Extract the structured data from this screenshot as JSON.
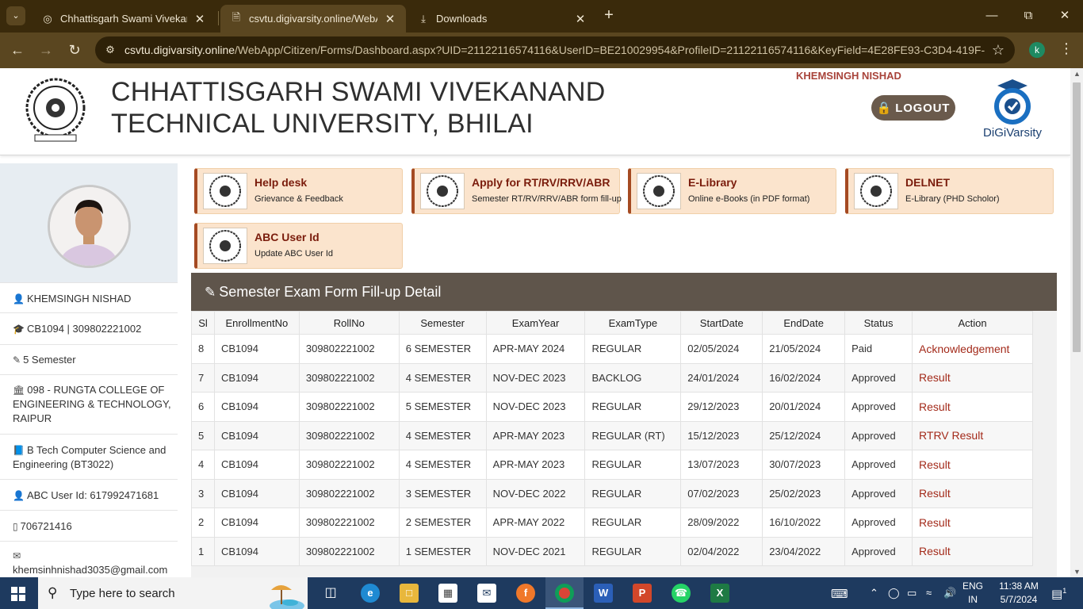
{
  "browser": {
    "tabs": [
      {
        "title": "Chhattisgarh Swami Vivekananda"
      },
      {
        "title": "csvtu.digivarsity.online/WebApp"
      },
      {
        "title": "Downloads"
      }
    ],
    "url_host": "csvtu.digivarsity.online",
    "url_path": "/WebApp/Citizen/Forms/Dashboard.aspx?UID=21122116574116&UserID=BE210029954&ProfileID=21122116574116&KeyField=4E28FE93-C3D4-419F-...",
    "profile_initial": "k"
  },
  "header": {
    "university_line1": "CHHATTISGARH SWAMI VIVEKANAND",
    "university_line2": "TECHNICAL UNIVERSITY, BHILAI",
    "user_name": "KHEMSINGH NISHAD",
    "logout_label": "LOGOUT",
    "logo_caption": "DiGiVarsity"
  },
  "sidebar": {
    "name": "KHEMSINGH NISHAD",
    "enrollment": "CB1094 | 309802221002",
    "semester": "5 Semester",
    "college": "098 - RUNGTA COLLEGE OF ENGINEERING & TECHNOLOGY, RAIPUR",
    "course": "B Tech Computer Science and Engineering (BT3022)",
    "abc_id": "ABC User Id: 617992471681",
    "phone": "706721416",
    "email": "khemsinhnishad3035@gmail.com"
  },
  "cards": [
    {
      "title": "Help desk",
      "subtitle": "Grievance & Feedback"
    },
    {
      "title": "Apply for RT/RV/RRV/ABR",
      "subtitle": "Semester RT/RV/RRV/ABR form fill-up"
    },
    {
      "title": "E-Library",
      "subtitle": "Online e-Books (in PDF format)"
    },
    {
      "title": "DELNET",
      "subtitle": "E-Library (PHD Scholor)"
    },
    {
      "title": "ABC User Id",
      "subtitle": "Update ABC User Id"
    }
  ],
  "exam_panel": {
    "title": "Semester Exam Form Fill-up Detail",
    "columns": [
      "Sl",
      "EnrollmentNo",
      "RollNo",
      "Semester",
      "ExamYear",
      "ExamType",
      "StartDate",
      "EndDate",
      "Status",
      "Action"
    ],
    "rows": [
      [
        "8",
        "CB1094",
        "309802221002",
        "6 SEMESTER",
        "APR-MAY 2024",
        "REGULAR",
        "02/05/2024",
        "21/05/2024",
        "Paid",
        "Acknowledgement"
      ],
      [
        "7",
        "CB1094",
        "309802221002",
        "4 SEMESTER",
        "NOV-DEC 2023",
        "BACKLOG",
        "24/01/2024",
        "16/02/2024",
        "Approved",
        "Result"
      ],
      [
        "6",
        "CB1094",
        "309802221002",
        "5 SEMESTER",
        "NOV-DEC 2023",
        "REGULAR",
        "29/12/2023",
        "20/01/2024",
        "Approved",
        "Result"
      ],
      [
        "5",
        "CB1094",
        "309802221002",
        "4 SEMESTER",
        "APR-MAY 2023",
        "REGULAR (RT)",
        "15/12/2023",
        "25/12/2024",
        "Approved",
        "RTRV Result"
      ],
      [
        "4",
        "CB1094",
        "309802221002",
        "4 SEMESTER",
        "APR-MAY 2023",
        "REGULAR",
        "13/07/2023",
        "30/07/2023",
        "Approved",
        "Result"
      ],
      [
        "3",
        "CB1094",
        "309802221002",
        "3 SEMESTER",
        "NOV-DEC 2022",
        "REGULAR",
        "07/02/2023",
        "25/02/2023",
        "Approved",
        "Result"
      ],
      [
        "2",
        "CB1094",
        "309802221002",
        "2 SEMESTER",
        "APR-MAY 2022",
        "REGULAR",
        "28/09/2022",
        "16/10/2022",
        "Approved",
        "Result"
      ],
      [
        "1",
        "CB1094",
        "309802221002",
        "1 SEMESTER",
        "NOV-DEC 2021",
        "REGULAR",
        "02/04/2022",
        "23/04/2022",
        "Approved",
        "Result"
      ]
    ]
  },
  "taskbar": {
    "search_placeholder": "Type here to search",
    "lang_line1": "ENG",
    "lang_line2": "IN",
    "time": "11:38 AM",
    "date": "5/7/2024",
    "notification_count": "1"
  },
  "colors": {
    "chrome_frame": "#3a2a0b",
    "chrome_toolbar": "#5a4620",
    "accent_maroon": "#a32a1a",
    "card_bg": "#fbe4cd",
    "panel_header": "#5f554b",
    "taskbar": "#1e3a5f"
  }
}
